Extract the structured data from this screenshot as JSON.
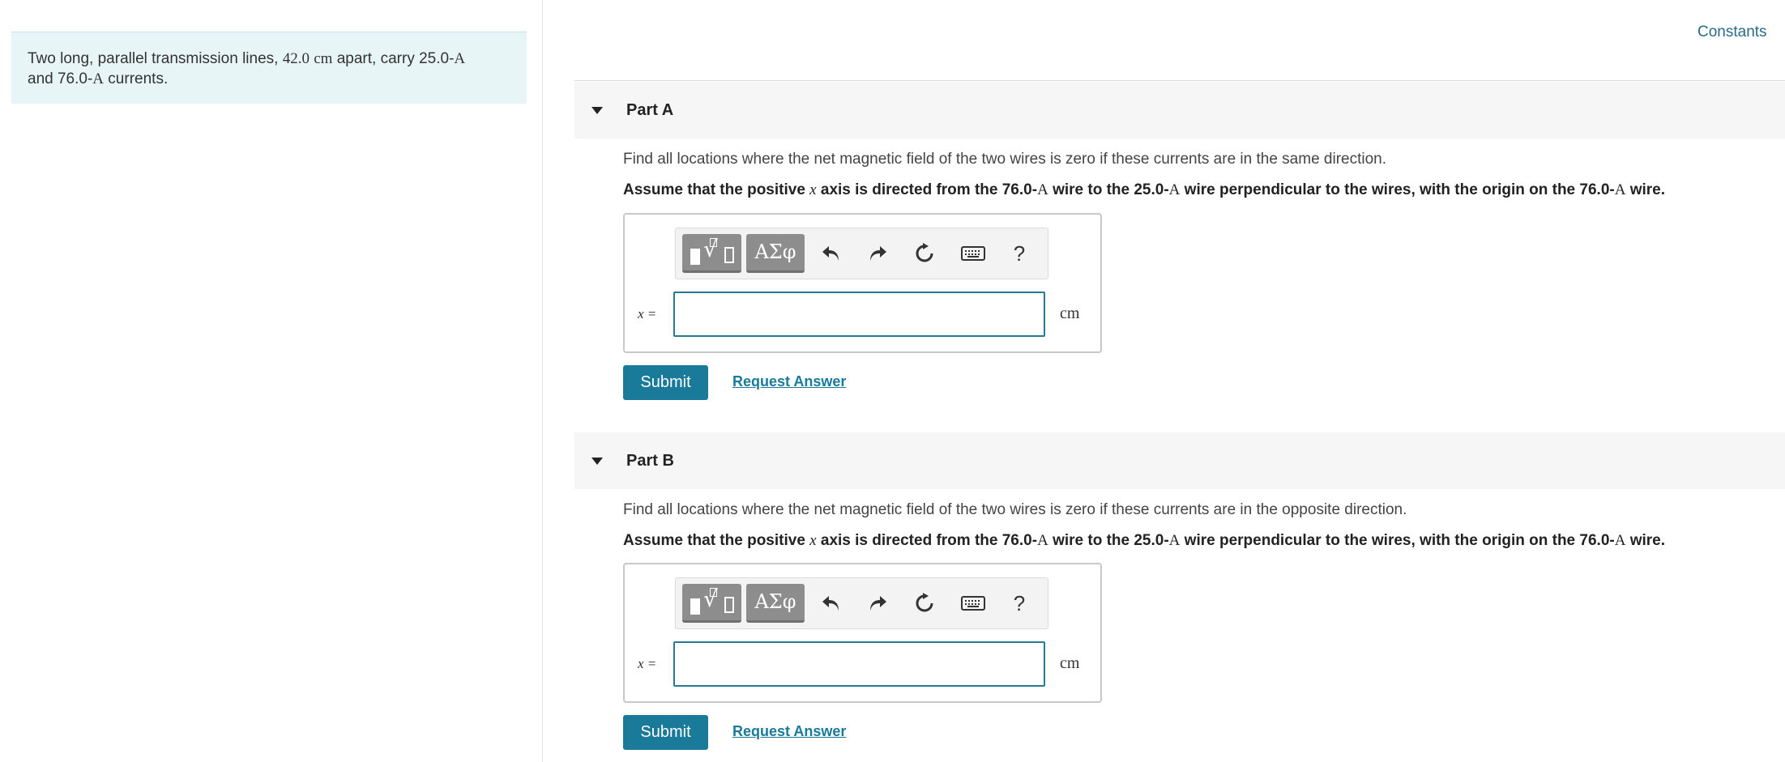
{
  "problem": {
    "t1": "Two long, parallel transmission lines, ",
    "d_val": "42.0",
    "d_unit": "cm",
    "t2": " apart, carry ",
    "i1_val": "25.0-",
    "i1_unit": "A",
    "t3": "and ",
    "i2_val": "76.0-",
    "i2_unit": "A",
    "t4": " currents."
  },
  "header": {
    "constants_label": "Constants"
  },
  "parts": [
    {
      "title": "Part A",
      "question": "Find all locations where the net magnetic field of the two wires is zero if these currents are in the same direction.",
      "assume": {
        "a1": "Assume that the positive ",
        "var": "x",
        "a2": " axis is directed from the 76.0-",
        "u1": "A",
        "a3": " wire to the 25.0-",
        "u2": "A",
        "a4": " wire perpendicular to the wires, with the origin on the 76.0-",
        "u3": "A",
        "a5": " wire."
      },
      "var_label": "x =",
      "unit": "cm",
      "input_value": "",
      "submit_label": "Submit",
      "request_label": "Request Answer"
    },
    {
      "title": "Part B",
      "question": "Find all locations where the net magnetic field of the two wires is zero if these currents are in the opposite direction.",
      "assume": {
        "a1": "Assume that the positive ",
        "var": "x",
        "a2": " axis is directed from the 76.0-",
        "u1": "A",
        "a3": " wire to the 25.0-",
        "u2": "A",
        "a4": " wire perpendicular to the wires, with the origin on the 76.0-",
        "u3": "A",
        "a5": " wire."
      },
      "var_label": "x =",
      "unit": "cm",
      "input_value": "",
      "submit_label": "Submit",
      "request_label": "Request Answer"
    }
  ],
  "toolbar": {
    "greek_label": "ΑΣφ",
    "help_label": "?",
    "icons": [
      "templates-icon",
      "greek-symbols-icon",
      "undo-icon",
      "redo-icon",
      "reset-icon",
      "keyboard-icon",
      "help-icon"
    ]
  },
  "colors": {
    "accent": "#1a7a99",
    "problem_bg": "#e7f5f6",
    "link": "#2b6a88",
    "toolbar_button": "#8d8d8d"
  }
}
